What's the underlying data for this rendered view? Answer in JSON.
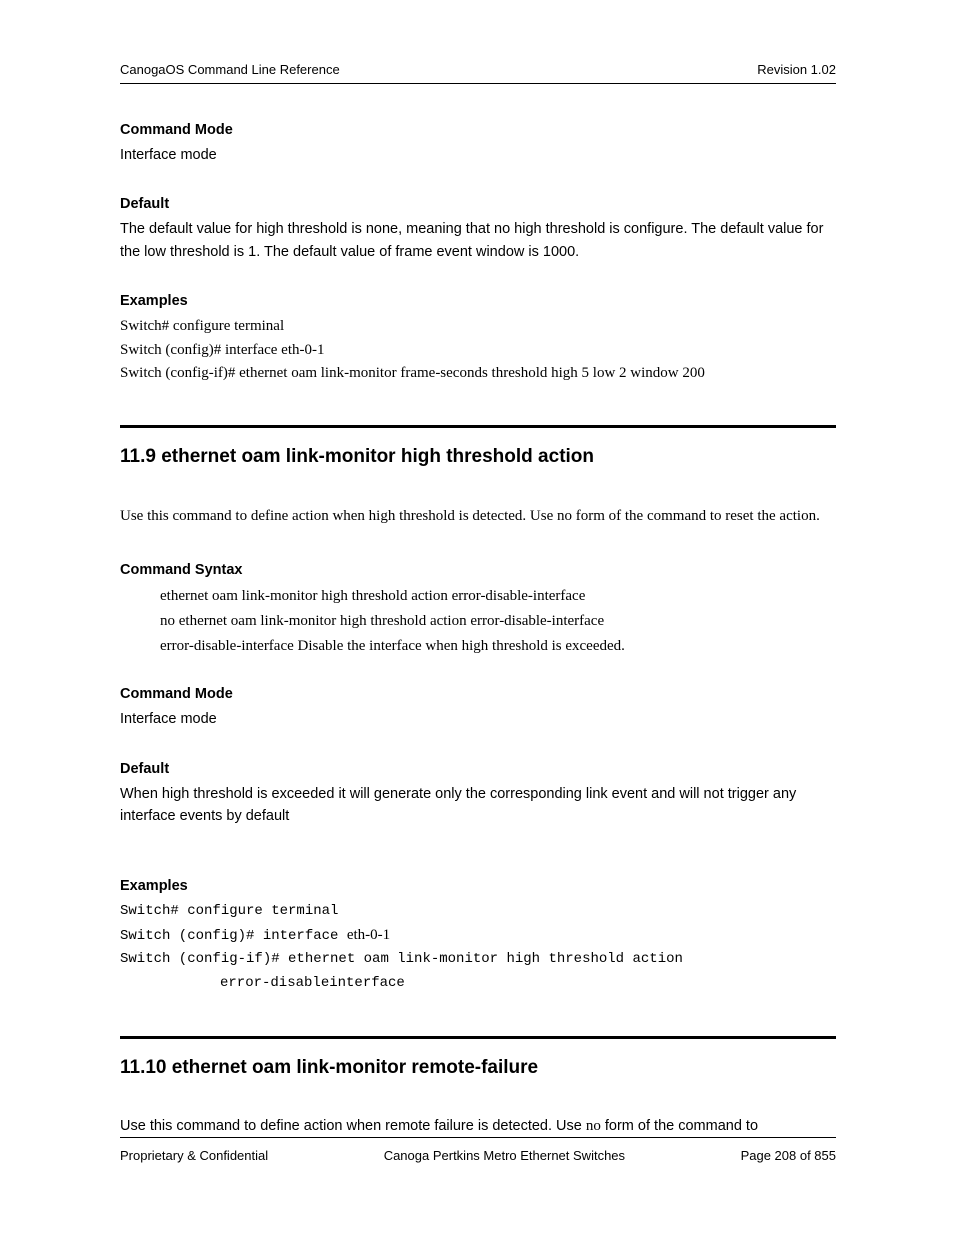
{
  "header": {
    "left": "CanogaOS Command Line Reference",
    "right": "Revision 1.02"
  },
  "sec1": {
    "cmdmode_label": "Command Mode",
    "cmdmode_text": "Interface mode",
    "default_label": "Default",
    "default_text": "The default value for high threshold is none, meaning that no high threshold is configure. The default value for the low threshold is 1. The default value of frame event window is 1000.",
    "examples_label": "Examples",
    "ex1": "Switch# configure terminal",
    "ex2": "Switch (config)# interface eth-0-1",
    "ex3": "Switch (config-if)# ethernet oam link-monitor frame-seconds threshold high 5 low 2 window 200"
  },
  "sec2": {
    "title": "11.9 ethernet oam link-monitor high threshold action",
    "intro": "Use this command to define action when high threshold is detected. Use no form of the command to reset the action.",
    "syntax_label": "Command Syntax",
    "syntax_l1": "ethernet oam link-monitor high threshold action error-disable-interface",
    "syntax_l2": "no ethernet oam link-monitor high threshold action error-disable-interface",
    "syntax_l3": "error-disable-interface Disable the interface when high threshold is exceeded.",
    "cmdmode_label": "Command Mode",
    "cmdmode_text": "Interface mode",
    "default_label": "Default",
    "default_text": "When high threshold is exceeded it will generate only the corresponding link event and will not trigger any interface events by default",
    "examples_label": "Examples",
    "ex1": "Switch# configure terminal",
    "ex2a": "Switch (config)# interface ",
    "ex2b": "eth-0-1",
    "ex3": "Switch (config-if)# ethernet oam link-monitor high threshold action",
    "ex4": "error-disableinterface"
  },
  "sec3": {
    "title": "11.10  ethernet oam link-monitor remote-failure",
    "intro_a": "Use this command to define action when remote failure is detected. Use ",
    "intro_no": "no",
    "intro_b": " form of the command to"
  },
  "footer": {
    "left": "Proprietary & Confidential",
    "center": "Canoga Pertkins Metro Ethernet Switches",
    "right": "Page 208 of 855"
  }
}
